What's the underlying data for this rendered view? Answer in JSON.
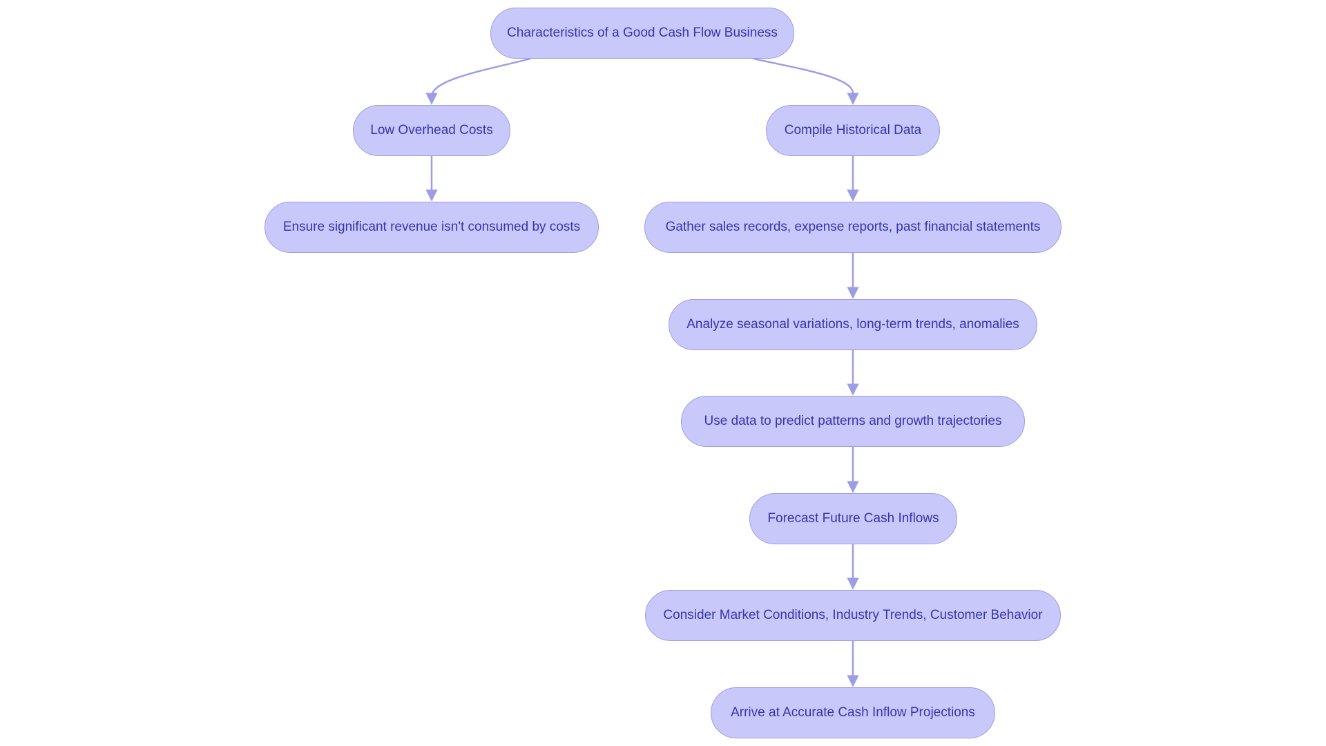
{
  "diagram": {
    "type": "flowchart",
    "colors": {
      "node_fill": "#c8c8fb",
      "node_border": "#9d9de6",
      "edge": "#9d9de6",
      "text": "#3535ad",
      "background": "#ffffff"
    },
    "nodes": [
      {
        "id": "root",
        "label": "Characteristics of a Good Cash Flow Business"
      },
      {
        "id": "low_overhead",
        "label": "Low Overhead Costs"
      },
      {
        "id": "ensure_revenue",
        "label": "Ensure significant revenue isn't consumed by costs"
      },
      {
        "id": "compile_data",
        "label": "Compile Historical Data"
      },
      {
        "id": "gather_records",
        "label": "Gather sales records, expense reports, past financial statements"
      },
      {
        "id": "analyze",
        "label": "Analyze seasonal variations, long-term trends, anomalies"
      },
      {
        "id": "predict",
        "label": "Use data to predict patterns and growth trajectories"
      },
      {
        "id": "forecast",
        "label": "Forecast Future Cash Inflows"
      },
      {
        "id": "consider",
        "label": "Consider Market Conditions, Industry Trends, Customer Behavior"
      },
      {
        "id": "arrive",
        "label": "Arrive at Accurate Cash Inflow Projections"
      }
    ],
    "edges": [
      {
        "from": "root",
        "to": "low_overhead"
      },
      {
        "from": "low_overhead",
        "to": "ensure_revenue"
      },
      {
        "from": "root",
        "to": "compile_data"
      },
      {
        "from": "compile_data",
        "to": "gather_records"
      },
      {
        "from": "gather_records",
        "to": "analyze"
      },
      {
        "from": "analyze",
        "to": "predict"
      },
      {
        "from": "predict",
        "to": "forecast"
      },
      {
        "from": "forecast",
        "to": "consider"
      },
      {
        "from": "consider",
        "to": "arrive"
      }
    ]
  }
}
